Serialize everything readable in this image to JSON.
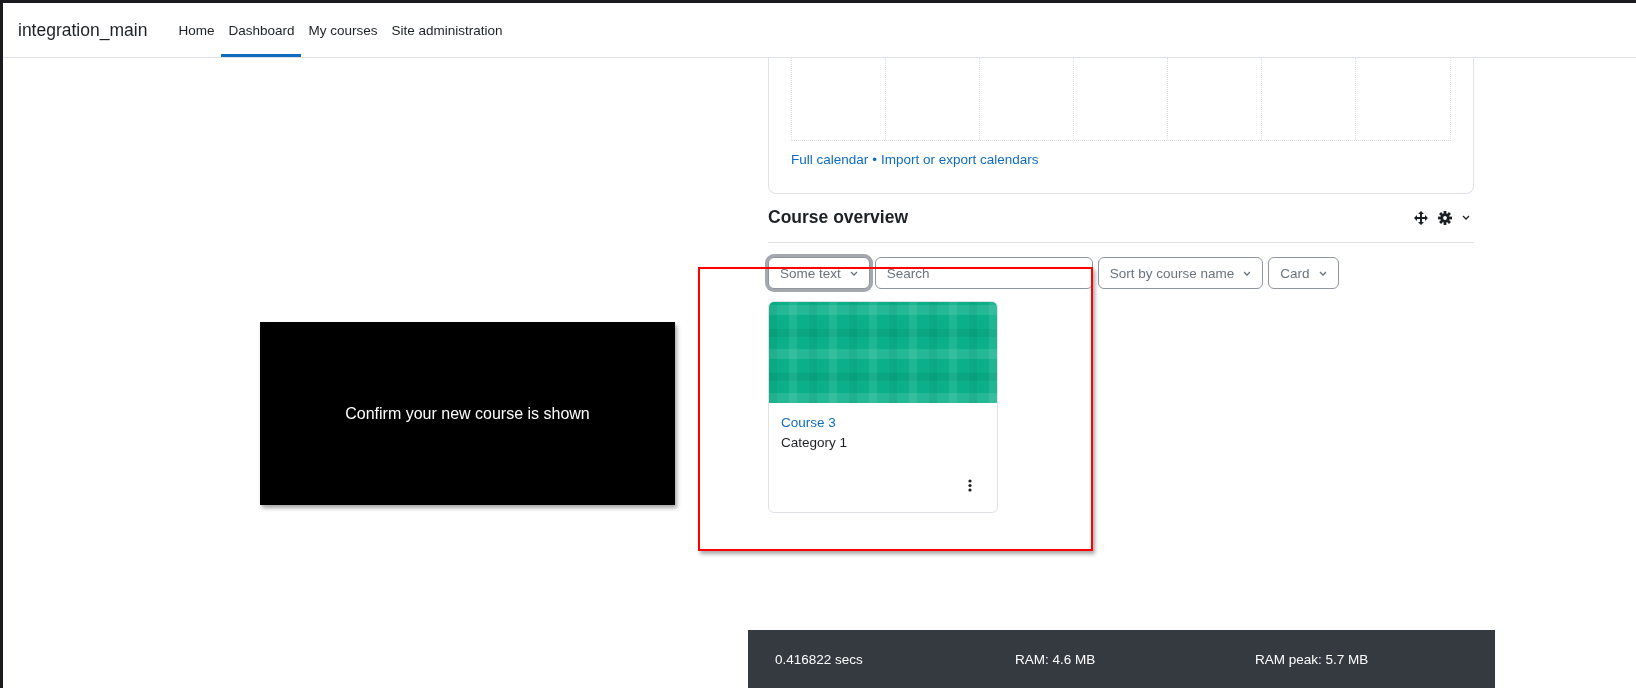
{
  "navbar": {
    "brand": "integration_main",
    "items": [
      {
        "label": "Home",
        "selected": false
      },
      {
        "label": "Dashboard",
        "selected": true
      },
      {
        "label": "My courses",
        "selected": false
      },
      {
        "label": "Site administration",
        "selected": false
      }
    ]
  },
  "calendar": {
    "links": [
      "Full calendar",
      "Import or export calendars"
    ],
    "separator": "•"
  },
  "course_overview": {
    "title": "Course overview",
    "filters": [
      {
        "kind": "dropdown",
        "label": "Some text",
        "focused": true
      },
      {
        "kind": "search",
        "placeholder": "Search"
      },
      {
        "kind": "dropdown",
        "label": "Sort by course name",
        "focused": false
      },
      {
        "kind": "dropdown",
        "label": "Card",
        "focused": false
      }
    ],
    "courses": [
      {
        "name": "Course 3",
        "category": "Category 1"
      }
    ]
  },
  "callout": {
    "text": "Confirm your new course is shown"
  },
  "footer": {
    "items": [
      "0.416822 secs",
      "RAM: 4.6 MB",
      "RAM peak: 5.7 MB"
    ]
  }
}
